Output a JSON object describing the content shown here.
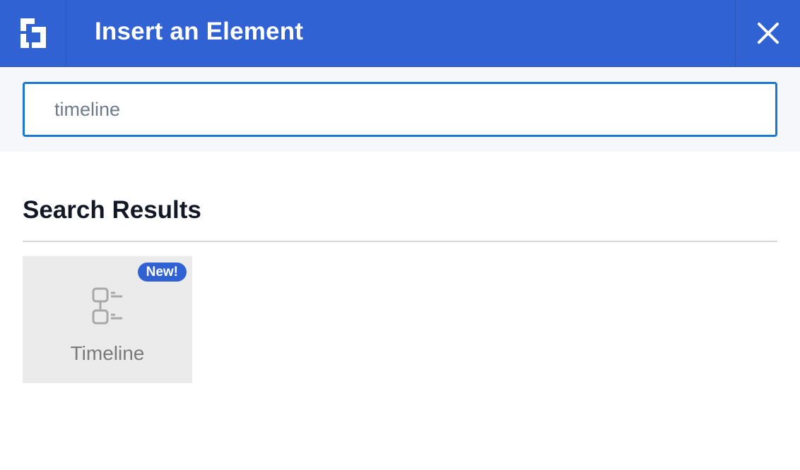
{
  "header": {
    "title": "Insert an Element",
    "logo_icon": "brand-logo-icon",
    "close_icon": "close-icon",
    "color": "#3162d3"
  },
  "search": {
    "value": "timeline",
    "placeholder": ""
  },
  "results": {
    "heading": "Search Results",
    "items": [
      {
        "label": "Timeline",
        "badge": "New!",
        "icon": "timeline-icon"
      }
    ]
  },
  "colors": {
    "accent": "#3162d3",
    "focus_border": "#1a77d2",
    "tile_bg": "#ebebeb"
  }
}
